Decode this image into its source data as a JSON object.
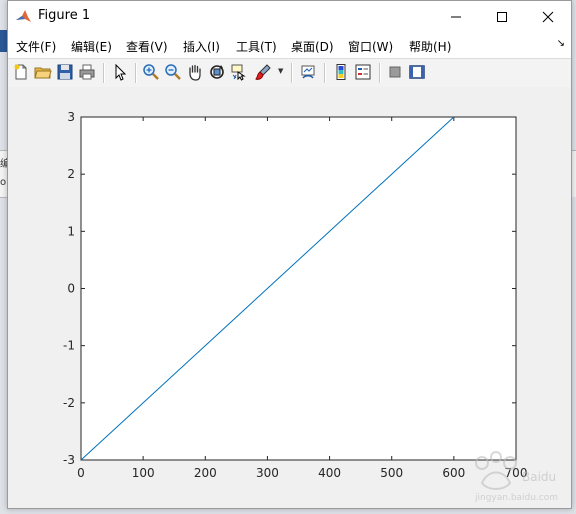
{
  "window": {
    "title": "Figure 1"
  },
  "menu": [
    "文件(F)",
    "编辑(E)",
    "查看(V)",
    "插入(I)",
    "工具(T)",
    "桌面(D)",
    "窗口(W)",
    "帮助(H)"
  ],
  "toolbar": {
    "buttons": [
      "new-figure-icon",
      "open-file-icon",
      "save-icon",
      "print-icon",
      "edit-plot-arrow-icon",
      "zoom-in-icon",
      "zoom-out-icon",
      "pan-hand-icon",
      "rotate-3d-icon",
      "data-cursor-icon",
      "brush-icon",
      "link-plot-icon",
      "colorbar-icon",
      "legend-icon",
      "hide-plot-tools-icon",
      "show-plot-tools-icon"
    ]
  },
  "background": {
    "left_fragment_1": "编",
    "left_fragment_2": "o."
  },
  "chart_data": {
    "type": "line",
    "x": [
      0,
      600
    ],
    "y": [
      -3,
      3
    ],
    "xlim": [
      0,
      700
    ],
    "ylim": [
      -3,
      3
    ],
    "x_ticks": [
      "0",
      "100",
      "200",
      "300",
      "400",
      "500",
      "600",
      "700"
    ],
    "y_ticks": [
      "3",
      "2",
      "1",
      "0",
      "-1",
      "-2",
      "-3"
    ],
    "line_color": "#0072bd",
    "grid": false,
    "title": "",
    "xlabel": "",
    "ylabel": ""
  },
  "watermark": {
    "line1": "Baidu",
    "line2": "jingyan.baidu.com"
  }
}
